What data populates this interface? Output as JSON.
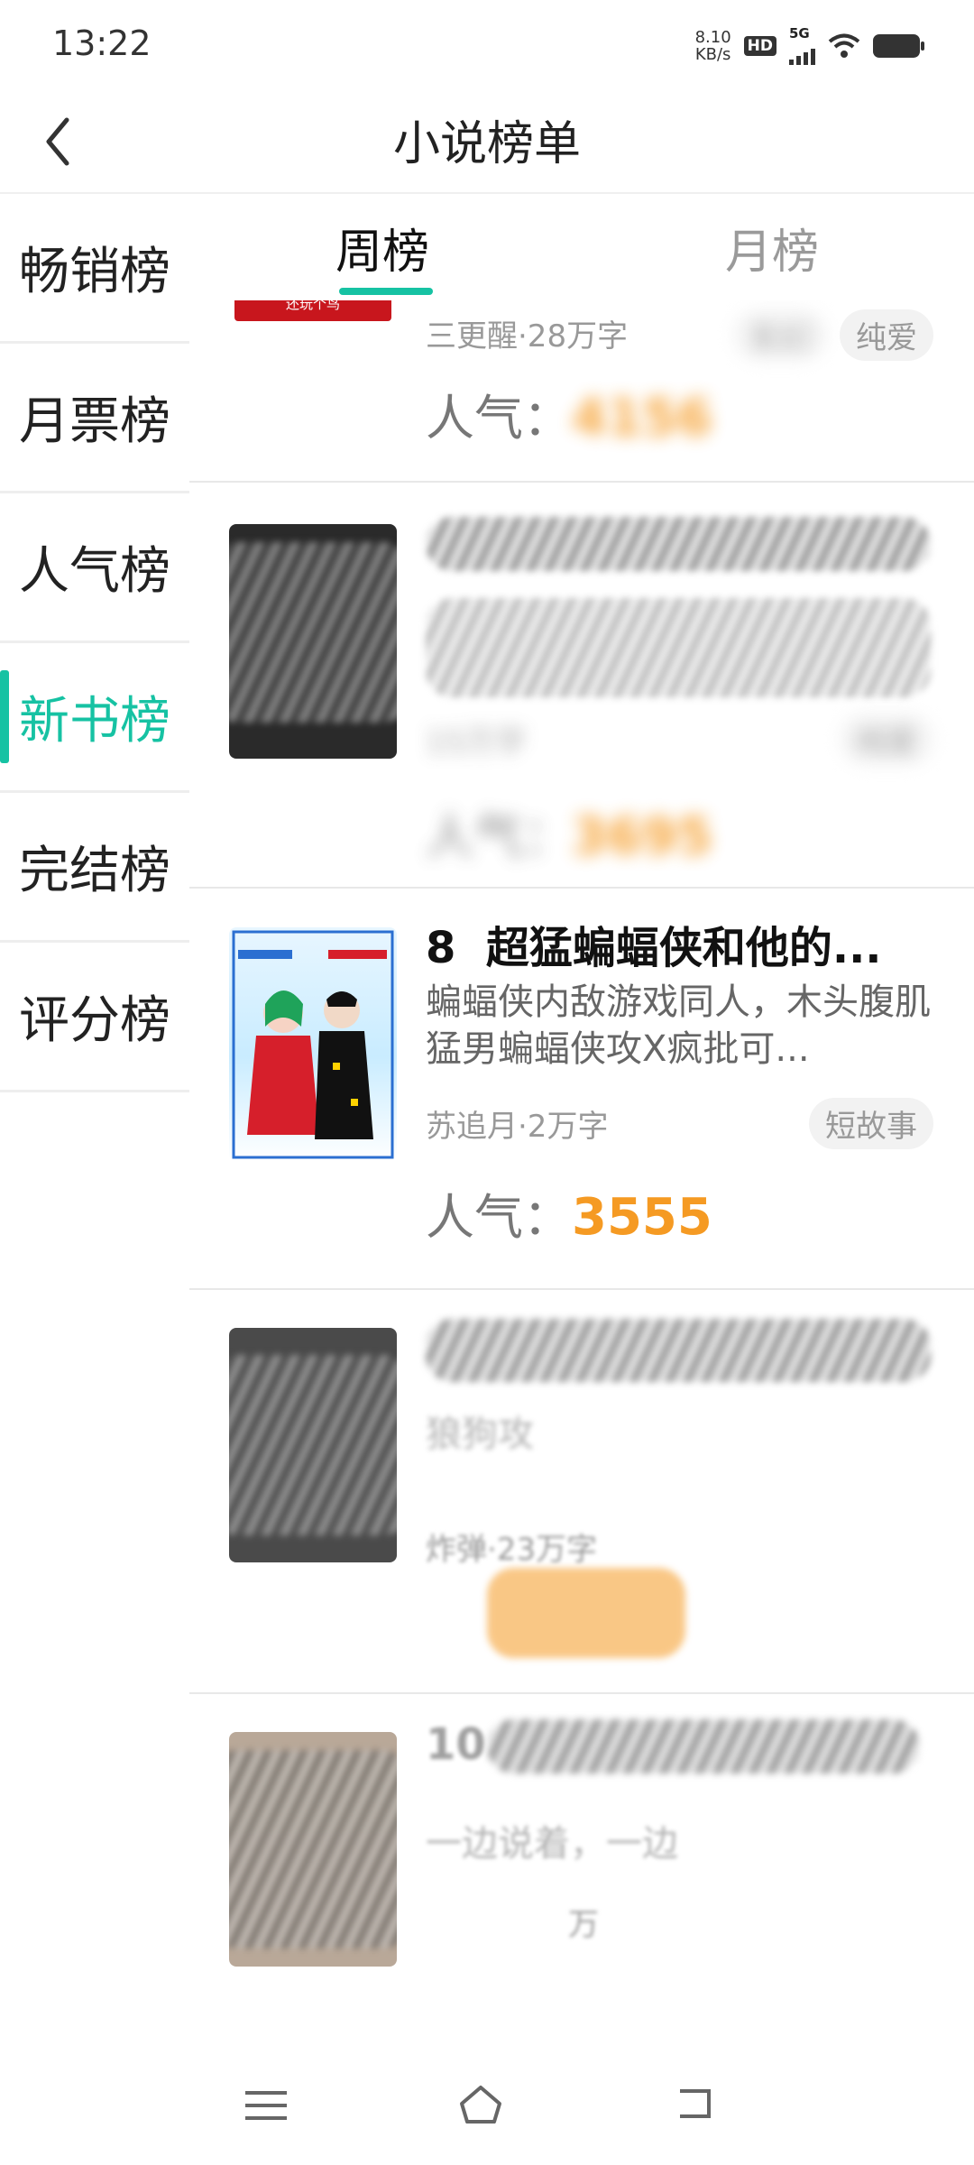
{
  "status_bar": {
    "time": "13:22",
    "net_speed_value": "8.10",
    "net_speed_unit": "KB/s",
    "hd": "HD",
    "network": "5G"
  },
  "header": {
    "title": "小说榜单"
  },
  "sidebar": {
    "items": [
      {
        "label": "畅销榜"
      },
      {
        "label": "月票榜"
      },
      {
        "label": "人气榜"
      },
      {
        "label": "新书榜",
        "active": true
      },
      {
        "label": "完结榜"
      },
      {
        "label": "评分榜"
      }
    ]
  },
  "tabs": [
    {
      "label": "周榜",
      "active": true
    },
    {
      "label": "月榜"
    }
  ],
  "popularity_label": "人气：",
  "books": [
    {
      "meta": "三更醒·28万字",
      "tags": [
        "玄幻",
        "纯爱"
      ],
      "popularity": "4156",
      "cover_text": "还玩个鸟"
    },
    {
      "meta": "15万字",
      "tags": [
        "纯爱"
      ],
      "popularity": "3695"
    },
    {
      "rank": "8",
      "title": "超猛蝙蝠侠和他的...",
      "desc": "蝙蝠侠内敌游戏同人，木头腹肌猛男蝙蝠侠攻X疯批可...",
      "meta": "苏追月·2万字",
      "tags": [
        "短故事"
      ],
      "popularity": "3555"
    },
    {
      "desc_fragment": "狼狗攻",
      "meta": "炸弹·23万字"
    },
    {
      "rank": "10",
      "desc_fragment": "一边说着，一边",
      "meta": "万"
    }
  ],
  "colors": {
    "accent": "#16c2a3",
    "popularity": "#f59a23"
  }
}
